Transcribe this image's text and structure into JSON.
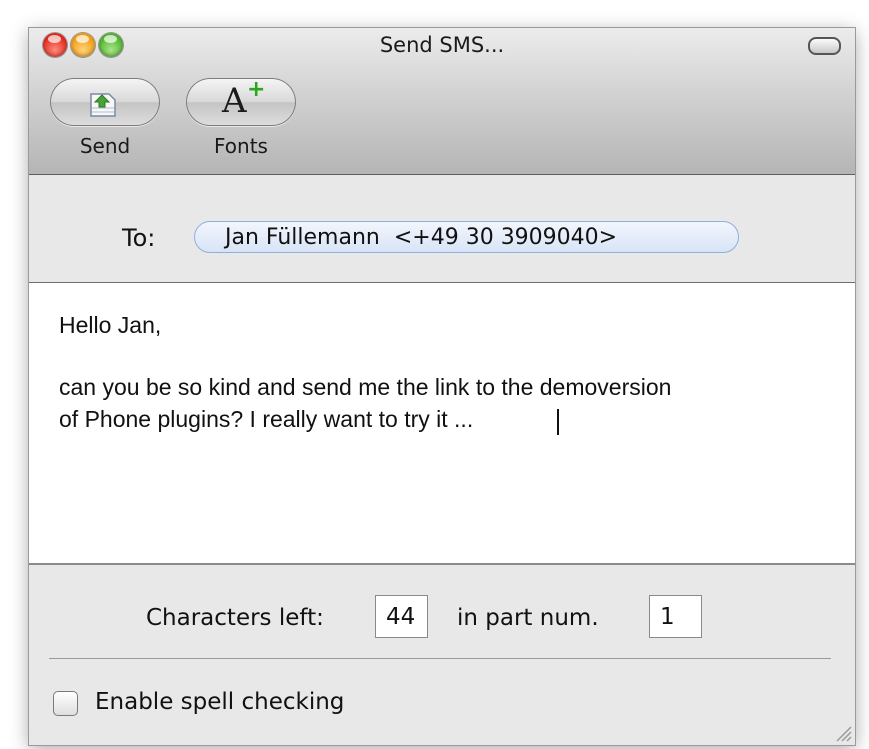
{
  "window": {
    "title": "Send SMS..."
  },
  "toolbar": {
    "items": [
      {
        "label": "Send",
        "icon": "send-icon"
      },
      {
        "label": "Fonts",
        "icon": "fonts-icon"
      }
    ],
    "fonts_glyph": "A",
    "fonts_plus": "+"
  },
  "recipient": {
    "label": "To:",
    "name": "Jan Füllemann",
    "number": "<+49 30 3909040>",
    "token_text": "Jan Füllemann  <+49 30 3909040>"
  },
  "message": {
    "lines": [
      "Hello Jan,",
      "can you be so kind and send me the link to the demoversion",
      "of Phone plugins? I really want to try it ..."
    ]
  },
  "footer": {
    "chars_left_label": "Characters left:",
    "chars_left_value": "44",
    "part_label": "in part num.",
    "part_value": "1",
    "spell_check_label": "Enable spell checking",
    "spell_check_checked": false
  },
  "colors": {
    "close": "#e0251a",
    "minimize": "#f19a0f",
    "zoom": "#4bb228",
    "token_bg": "#d8e4f6",
    "token_border": "#8fb0dc",
    "fonts_plus": "#2da51e"
  }
}
